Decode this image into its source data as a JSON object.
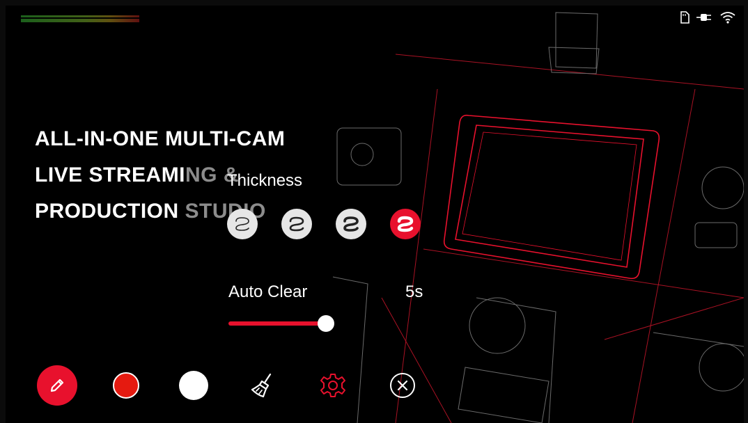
{
  "headline": {
    "line1": "ALL-IN-ONE MULTI-CAM",
    "line2_a": "LIVE STREAMI",
    "line2_b": "NG &",
    "line3_a": "PRODUCTION ",
    "line3_b": "STUDIO"
  },
  "thickness": {
    "label": "Thickness",
    "options": [
      "thin",
      "medium",
      "thick",
      "extra-thick"
    ],
    "selected_index": 3
  },
  "auto_clear": {
    "label": "Auto Clear",
    "value": "5s",
    "slider_level": 1.0
  },
  "toolbar": {
    "items": [
      "pen-tool",
      "red-color",
      "white-color",
      "clear-brush",
      "settings",
      "close"
    ]
  },
  "colors": {
    "accent": "#e8112d",
    "red_swatch": "#e51a10",
    "white_swatch": "#ffffff"
  },
  "status": {
    "icons": [
      "sd-card-icon",
      "power-plug-icon",
      "wifi-icon"
    ]
  }
}
